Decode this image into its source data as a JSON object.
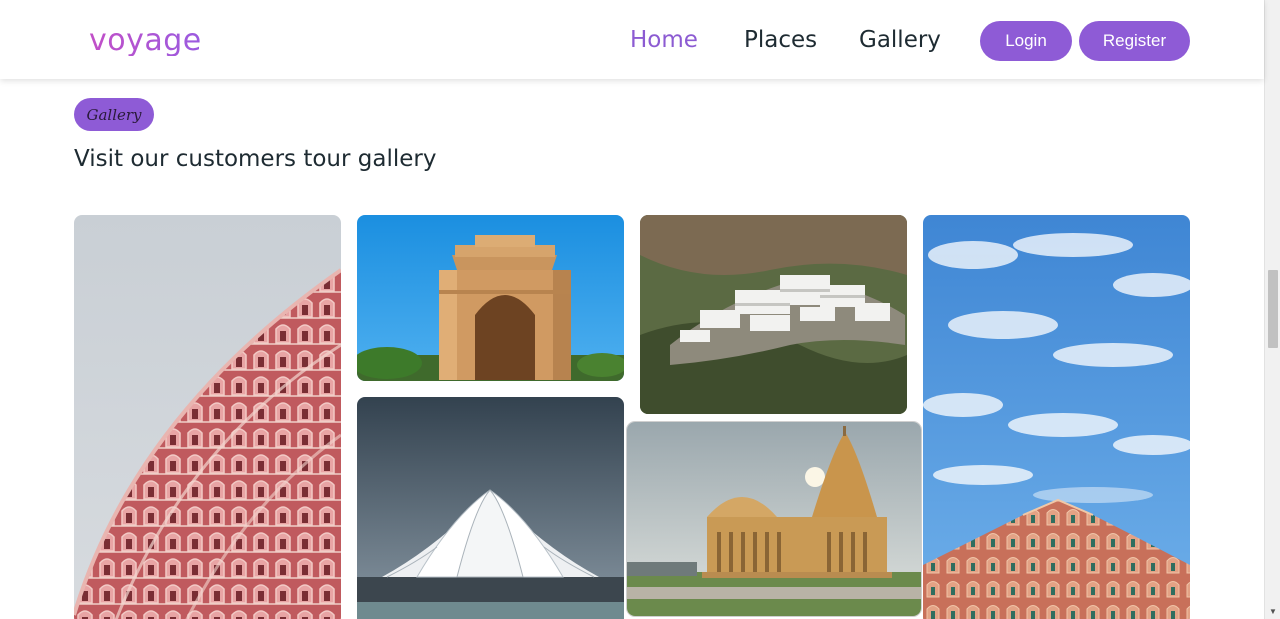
{
  "brand": {
    "logo": "voyage",
    "gradient": [
      "#c24fc7",
      "#9a5be0"
    ]
  },
  "nav": {
    "items": [
      {
        "label": "Home",
        "active": true
      },
      {
        "label": "Places",
        "active": false
      },
      {
        "label": "Gallery",
        "active": false
      }
    ],
    "login_label": "Login",
    "register_label": "Register"
  },
  "section": {
    "badge": "Gallery",
    "title": "Visit our customers tour gallery"
  },
  "gallery": {
    "images": [
      {
        "subject": "hawa-mahal-facade"
      },
      {
        "subject": "india-gate"
      },
      {
        "subject": "lotus-temple"
      },
      {
        "subject": "hillside-shrine-complex"
      },
      {
        "subject": "somnath-temple"
      },
      {
        "subject": "hawa-mahal-blue-sky"
      }
    ]
  },
  "colors": {
    "accent": "#8e5bd6",
    "active_nav": "#8c5bd2",
    "text": "#1e2b32"
  }
}
